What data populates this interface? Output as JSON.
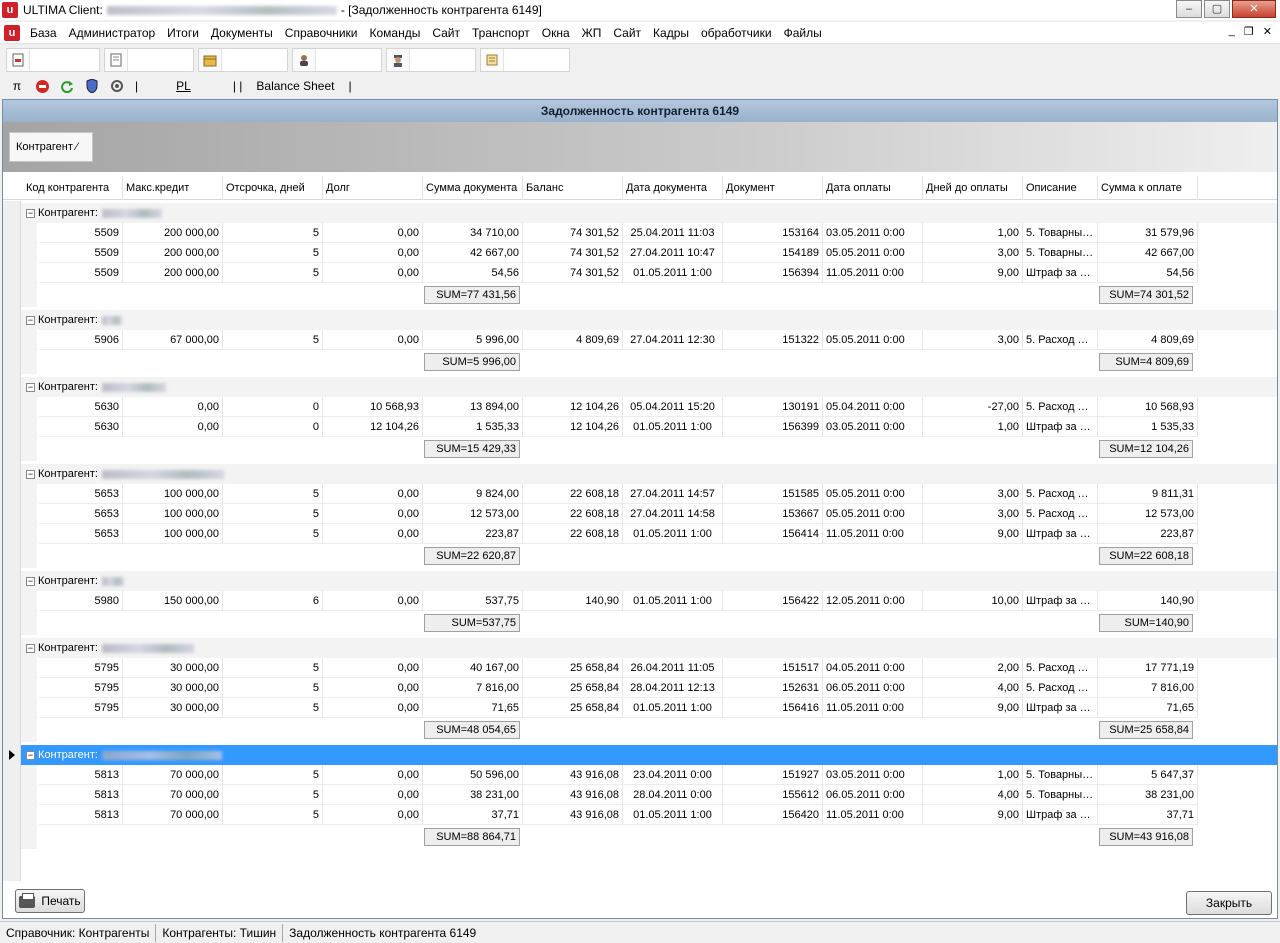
{
  "window": {
    "app_title_prefix": "ULTIMA Client:",
    "doc_title": "- [Задолженность контрагента 6149]",
    "logo_letter": "u",
    "btn_min": "–",
    "btn_max": "▢",
    "btn_close": "✕"
  },
  "menu": {
    "items": [
      "База",
      "Администратор",
      "Итоги",
      "Документы",
      "Справочники",
      "Команды",
      "Сайт",
      "Транспорт",
      "Окна",
      "ЖП",
      "Сайт",
      "Кадры",
      "обработчики",
      "Файлы"
    ],
    "mdi_min": "_",
    "mdi_restore": "❐",
    "mdi_close": "✕"
  },
  "toolbar2": {
    "pi": "π",
    "sep1": "|",
    "pl": "PL",
    "sep2": "| |",
    "balance_sheet": "Balance Sheet",
    "sep3": "|"
  },
  "child": {
    "title": "Задолженность контрагента 6149",
    "group_chip": "Контрагент"
  },
  "columns": [
    "Код контрагента",
    "Макс.кредит",
    "Отсрочка, дней",
    "Долг",
    "Сумма документа",
    "Баланс",
    "Дата документа",
    "Документ",
    "Дата оплаты",
    "Дней до оплаты",
    "Описание",
    "Сумма к оплате"
  ],
  "group_label": "Контрагент:",
  "groups": [
    {
      "rows": [
        [
          "5509",
          "200 000,00",
          "5",
          "0,00",
          "34 710,00",
          "74 301,52",
          "25.04.2011 11:03",
          "153164",
          "03.05.2011 0:00",
          "1,00",
          "5. Товарны…",
          "31 579,96"
        ],
        [
          "5509",
          "200 000,00",
          "5",
          "0,00",
          "42 667,00",
          "74 301,52",
          "27.04.2011 10:47",
          "154189",
          "05.05.2011 0:00",
          "3,00",
          "5. Товарны…",
          "42 667,00"
        ],
        [
          "5509",
          "200 000,00",
          "5",
          "0,00",
          "54,56",
          "74 301,52",
          "01.05.2011 1:00",
          "156394",
          "11.05.2011 0:00",
          "9,00",
          "Штраф за …",
          "54,56"
        ]
      ],
      "sum_doc": "SUM=77 431,56",
      "sum_pay": "SUM=74 301,52"
    },
    {
      "rows": [
        [
          "5906",
          "67 000,00",
          "5",
          "0,00",
          "5 996,00",
          "4 809,69",
          "27.04.2011 12:30",
          "151322",
          "05.05.2011 0:00",
          "3,00",
          "5. Расход …",
          "4 809,69"
        ]
      ],
      "sum_doc": "SUM=5 996,00",
      "sum_pay": "SUM=4 809,69"
    },
    {
      "rows": [
        [
          "5630",
          "0,00",
          "0",
          "10 568,93",
          "13 894,00",
          "12 104,26",
          "05.04.2011 15:20",
          "130191",
          "05.04.2011 0:00",
          "-27,00",
          "5. Расход …",
          "10 568,93"
        ],
        [
          "5630",
          "0,00",
          "0",
          "12 104,26",
          "1 535,33",
          "12 104,26",
          "01.05.2011 1:00",
          "156399",
          "03.05.2011 0:00",
          "1,00",
          "Штраф за …",
          "1 535,33"
        ]
      ],
      "sum_doc": "SUM=15 429,33",
      "sum_pay": "SUM=12 104,26"
    },
    {
      "rows": [
        [
          "5653",
          "100 000,00",
          "5",
          "0,00",
          "9 824,00",
          "22 608,18",
          "27.04.2011 14:57",
          "151585",
          "05.05.2011 0:00",
          "3,00",
          "5. Расход …",
          "9 811,31"
        ],
        [
          "5653",
          "100 000,00",
          "5",
          "0,00",
          "12 573,00",
          "22 608,18",
          "27.04.2011 14:58",
          "153667",
          "05.05.2011 0:00",
          "3,00",
          "5. Расход …",
          "12 573,00"
        ],
        [
          "5653",
          "100 000,00",
          "5",
          "0,00",
          "223,87",
          "22 608,18",
          "01.05.2011 1:00",
          "156414",
          "11.05.2011 0:00",
          "9,00",
          "Штраф за …",
          "223,87"
        ]
      ],
      "sum_doc": "SUM=22 620,87",
      "sum_pay": "SUM=22 608,18"
    },
    {
      "rows": [
        [
          "5980",
          "150 000,00",
          "6",
          "0,00",
          "537,75",
          "140,90",
          "01.05.2011 1:00",
          "156422",
          "12.05.2011 0:00",
          "10,00",
          "Штраф за …",
          "140,90"
        ]
      ],
      "sum_doc": "SUM=537,75",
      "sum_pay": "SUM=140,90"
    },
    {
      "rows": [
        [
          "5795",
          "30 000,00",
          "5",
          "0,00",
          "40 167,00",
          "25 658,84",
          "26.04.2011 11:05",
          "151517",
          "04.05.2011 0:00",
          "2,00",
          "5. Расход …",
          "17 771,19"
        ],
        [
          "5795",
          "30 000,00",
          "5",
          "0,00",
          "7 816,00",
          "25 658,84",
          "28.04.2011 12:13",
          "152631",
          "06.05.2011 0:00",
          "4,00",
          "5. Расход …",
          "7 816,00"
        ],
        [
          "5795",
          "30 000,00",
          "5",
          "0,00",
          "71,65",
          "25 658,84",
          "01.05.2011 1:00",
          "156416",
          "11.05.2011 0:00",
          "9,00",
          "Штраф за …",
          "71,65"
        ]
      ],
      "sum_doc": "SUM=48 054,65",
      "sum_pay": "SUM=25 658,84"
    },
    {
      "selected": true,
      "rows": [
        [
          "5813",
          "70 000,00",
          "5",
          "0,00",
          "50 596,00",
          "43 916,08",
          "23.04.2011 0:00",
          "151927",
          "03.05.2011 0:00",
          "1,00",
          "5. Товарны…",
          "5 647,37"
        ],
        [
          "5813",
          "70 000,00",
          "5",
          "0,00",
          "38 231,00",
          "43 916,08",
          "28.04.2011 0:00",
          "155612",
          "06.05.2011 0:00",
          "4,00",
          "5. Товарны…",
          "38 231,00"
        ],
        [
          "5813",
          "70 000,00",
          "5",
          "0,00",
          "37,71",
          "43 916,08",
          "01.05.2011 1:00",
          "156420",
          "11.05.2011 0:00",
          "9,00",
          "Штраф за …",
          "37,71"
        ]
      ],
      "sum_doc": "SUM=88 864,71",
      "sum_pay": "SUM=43 916,08"
    }
  ],
  "buttons": {
    "print": "Печать",
    "close": "Закрыть"
  },
  "status": {
    "part1": "Справочник: Контрагенты",
    "part2": "Контрагенты: Тишин",
    "part3": "Задолженность контрагента 6149"
  },
  "colors": {
    "selection": "#3399ff",
    "header_band": "#99b2cc",
    "logo": "#d0202a"
  }
}
